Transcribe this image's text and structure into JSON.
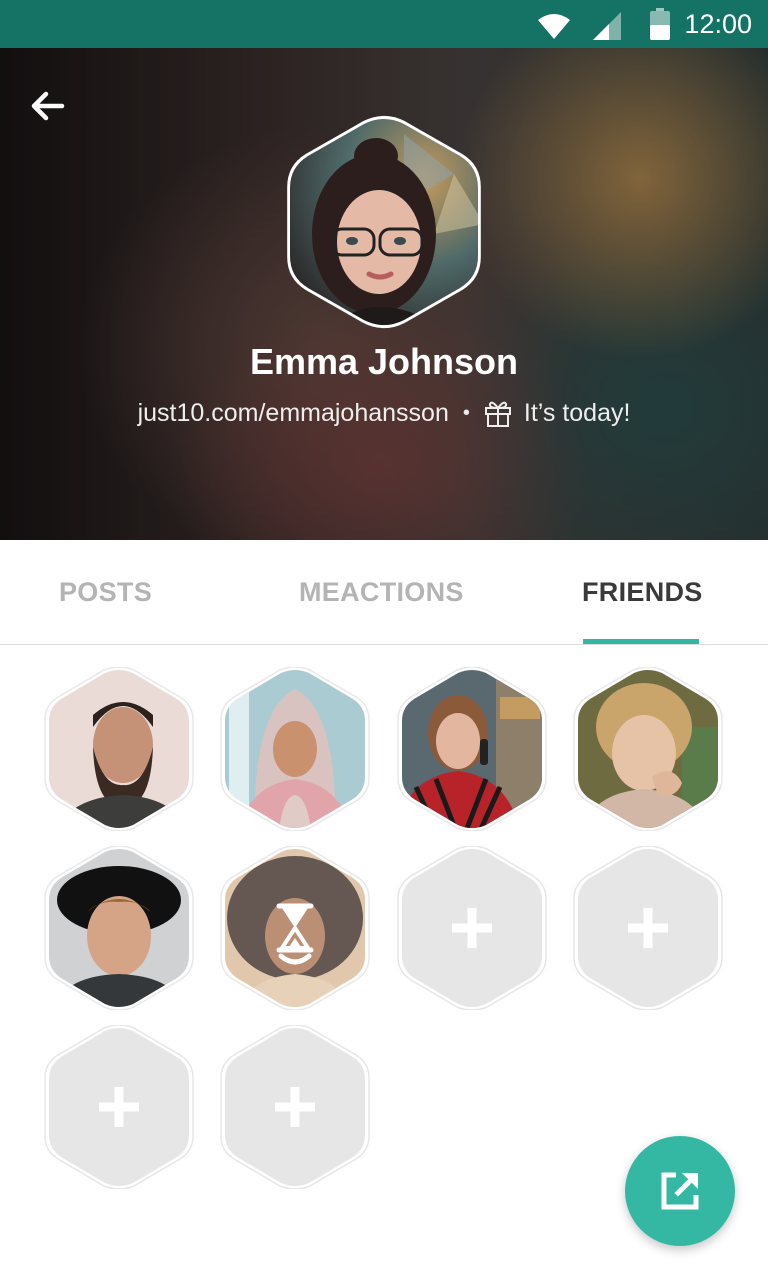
{
  "status_bar": {
    "time": "12:00"
  },
  "profile": {
    "name": "Emma Johnson",
    "url": "just10.com/emmajohansson",
    "separator": "•",
    "birthday_text": "It’s today!"
  },
  "tabs": [
    {
      "label": "POSTS",
      "active": false
    },
    {
      "label": "MEACTIONS",
      "active": false
    },
    {
      "label": "FRIENDS",
      "active": true
    }
  ],
  "friends": [
    {
      "kind": "photo",
      "description": "bearded man"
    },
    {
      "kind": "photo",
      "description": "woman in hijab"
    },
    {
      "kind": "photo",
      "description": "woman on phone"
    },
    {
      "kind": "photo",
      "description": "blonde woman"
    },
    {
      "kind": "photo",
      "description": "man in hat"
    },
    {
      "kind": "pending",
      "description": "curly-haired woman"
    },
    {
      "kind": "add"
    },
    {
      "kind": "add"
    },
    {
      "kind": "add"
    },
    {
      "kind": "add"
    }
  ],
  "colors": {
    "status_bar": "#157366",
    "accent": "#35b8a3",
    "tab_active": "#3a3a3a",
    "tab_inactive": "#b4b4b4",
    "placeholder_hex": "#e6e6e6"
  }
}
